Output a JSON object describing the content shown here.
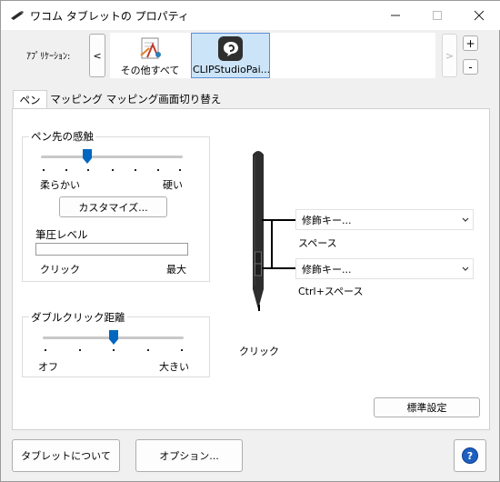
{
  "window": {
    "title": "ワコム タブレットの プロパティ",
    "minimize_icon": "minimize-icon",
    "maximize_icon": "maximize-icon",
    "close_icon": "close-icon"
  },
  "applications": {
    "label": "ｱﾌﾟﾘｹｰｼｮﾝ:",
    "scroll_left": "<",
    "scroll_right": ">",
    "add": "+",
    "remove": "-",
    "items": [
      {
        "label": "その他すべて"
      },
      {
        "label": "CLIPStudioPai..."
      }
    ]
  },
  "tabs": [
    {
      "label": "ペン"
    },
    {
      "label": "マッピング"
    },
    {
      "label": "マッピング画面切り替え"
    }
  ],
  "pen": {
    "tip_feel": {
      "title": "ペン先の感触",
      "left_label": "柔らかい",
      "right_label": "硬い",
      "level": 0.33,
      "customize_button": "カスタマイズ..."
    },
    "pressure": {
      "title": "筆圧レベル",
      "left_label": "クリック",
      "right_label": "最大",
      "level": 0
    },
    "double_click": {
      "title": "ダブルクリック距離",
      "left_label": "オフ",
      "right_label": "大きい",
      "level": 0.5
    },
    "side_switch_upper": {
      "value": "修飾キー...",
      "detail": "スペース"
    },
    "side_switch_lower": {
      "value": "修飾キー...",
      "detail": "Ctrl+スペース"
    },
    "tip_label": "クリック",
    "default_button": "標準設定"
  },
  "footer": {
    "about_button": "タブレットについて",
    "options_button": "オプション...",
    "help_icon": "help-icon",
    "help_symbol": "?"
  },
  "colors": {
    "accent": "#0067c0",
    "selected_app_bg": "#cce4f7",
    "selected_app_border": "#5b8fd6"
  }
}
